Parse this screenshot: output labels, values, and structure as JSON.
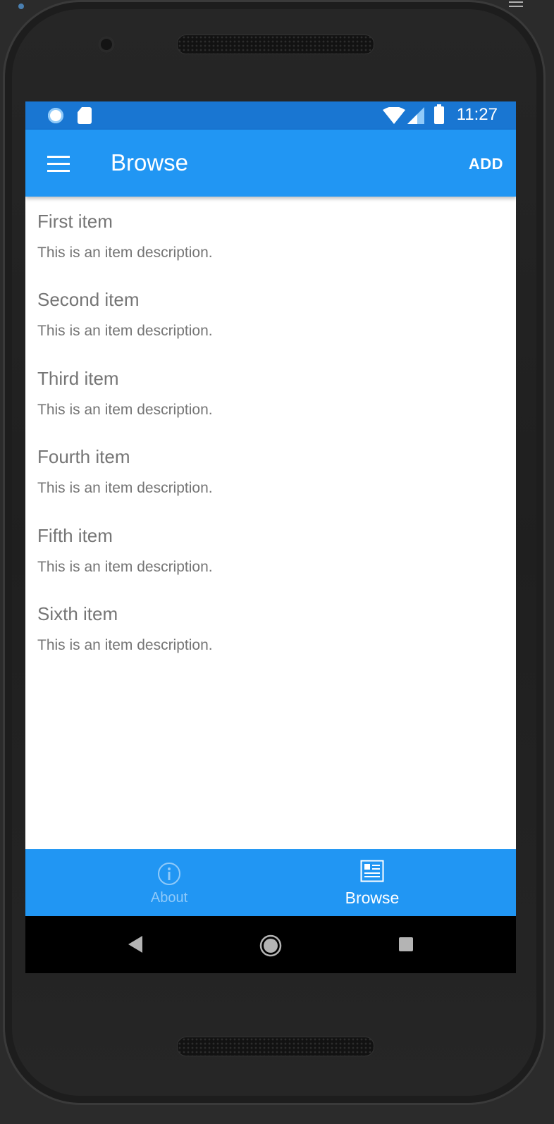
{
  "status_bar": {
    "time": "11:27",
    "icons": [
      "sync-icon",
      "sd-card-icon",
      "wifi-icon",
      "signal-icon",
      "battery-icon"
    ]
  },
  "app_bar": {
    "title": "Browse",
    "menu_icon": "hamburger-icon",
    "add_label": "ADD"
  },
  "items": [
    {
      "title": "First item",
      "description": "This is an item description."
    },
    {
      "title": "Second item",
      "description": "This is an item description."
    },
    {
      "title": "Third item",
      "description": "This is an item description."
    },
    {
      "title": "Fourth item",
      "description": "This is an item description."
    },
    {
      "title": "Fifth item",
      "description": "This is an item description."
    },
    {
      "title": "Sixth item",
      "description": "This is an item description."
    }
  ],
  "bottom_nav": {
    "tabs": [
      {
        "label": "About",
        "icon": "info-icon",
        "selected": false
      },
      {
        "label": "Browse",
        "icon": "browse-icon",
        "selected": true
      }
    ]
  },
  "system_nav": {
    "icons": [
      "back-icon",
      "home-icon",
      "recents-icon"
    ]
  },
  "colors": {
    "primary": "#2196f3",
    "primary_dark": "#1976d2",
    "text_secondary": "#757575",
    "tab_inactive": "#90caf9"
  }
}
